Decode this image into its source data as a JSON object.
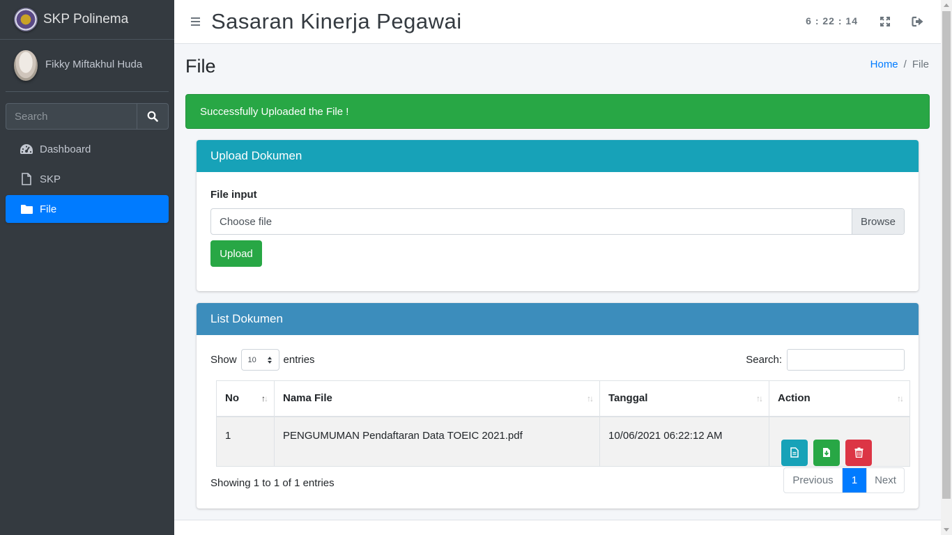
{
  "sidebar": {
    "brand": "SKP Polinema",
    "user_name": "Fikky Miftakhul Huda",
    "search_placeholder": "Search",
    "items": [
      {
        "label": "Dashboard",
        "icon": "tachometer-icon"
      },
      {
        "label": "SKP",
        "icon": "file-icon"
      },
      {
        "label": "File",
        "icon": "folder-icon",
        "active": true
      }
    ]
  },
  "topbar": {
    "title": "Sasaran Kinerja Pegawai",
    "clock": "6 : 22 : 14"
  },
  "page": {
    "title": "File",
    "breadcrumb": [
      "Home",
      "File"
    ]
  },
  "alert": {
    "text": "Successfully Uploaded the File !",
    "color": "#28a745"
  },
  "upload_card": {
    "header": "Upload Dokumen",
    "label": "File input",
    "placeholder": "Choose file",
    "browse": "Browse",
    "button": "Upload"
  },
  "list_card": {
    "header": "List Dokumen",
    "show_label": "Show",
    "entries_label": "entries",
    "page_length": "10",
    "search_label": "Search:",
    "columns": [
      "No",
      "Nama File",
      "Tanggal",
      "Action"
    ],
    "rows": [
      {
        "no": "1",
        "name": "PENGUMUMAN Pendaftaran Data TOEIC 2021.pdf",
        "date": "10/06/2021 06:22:12 AM"
      }
    ],
    "info": "Showing 1 to 1 of 1 entries",
    "pagination": {
      "previous": "Previous",
      "current": "1",
      "next": "Next"
    }
  },
  "colors": {
    "sidebar_bg": "#343a40",
    "primary": "#007bff",
    "info": "#17a2b8",
    "success": "#28a745",
    "danger": "#dc3545",
    "list_header": "#3c8dbc"
  }
}
